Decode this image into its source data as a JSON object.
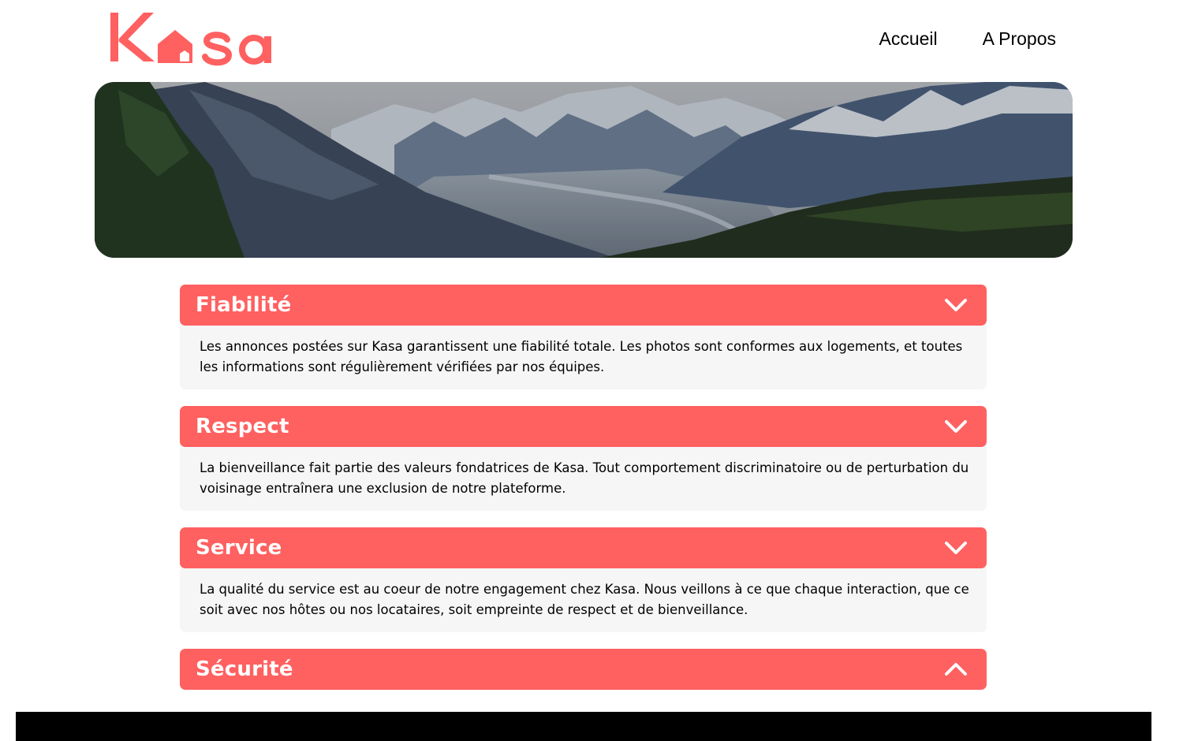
{
  "brand": {
    "name": "Kasa",
    "color": "#ff6060"
  },
  "nav": [
    {
      "label": "Accueil"
    },
    {
      "label": "A Propos"
    }
  ],
  "collapses": [
    {
      "title": "Fiabilité",
      "expanded": true,
      "chevron": "chevron-down-icon",
      "text": "Les annonces postées sur Kasa garantissent une fiabilité totale. Les photos sont conformes aux logements, et toutes les informations sont régulièrement vérifiées par nos équipes."
    },
    {
      "title": "Respect",
      "expanded": true,
      "chevron": "chevron-down-icon",
      "text": "La bienveillance fait partie des valeurs fondatrices de Kasa. Tout comportement discriminatoire ou de perturbation du voisinage entraînera une exclusion de notre plateforme."
    },
    {
      "title": "Service",
      "expanded": true,
      "chevron": "chevron-down-icon",
      "text": "La qualité du service est au coeur de notre engagement chez Kasa. Nous veillons à ce que chaque interaction, que ce soit avec nos hôtes ou nos locataires, soit empreinte de respect et de bienveillance."
    },
    {
      "title": "Sécurité",
      "expanded": false,
      "chevron": "chevron-up-icon",
      "text": ""
    }
  ],
  "colors": {
    "accent": "#ff6060",
    "panel": "#f6f6f6",
    "footer": "#000000"
  }
}
